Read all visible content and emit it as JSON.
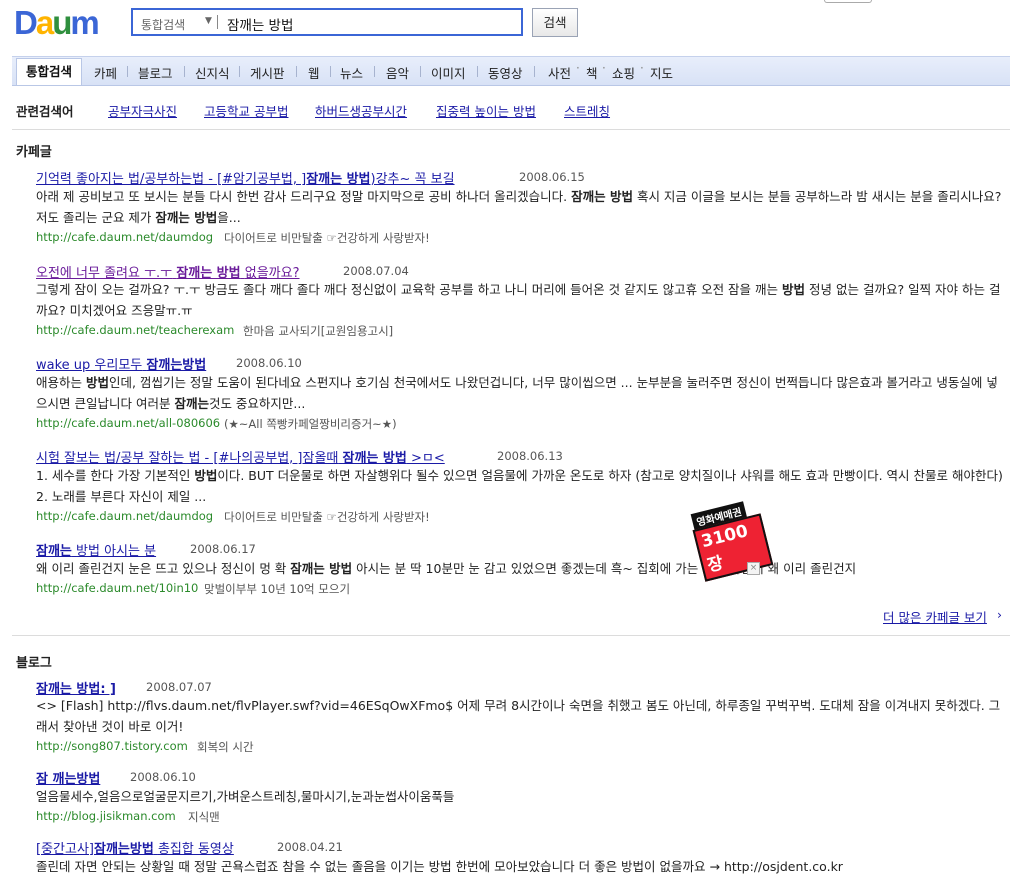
{
  "logo": {
    "text": "Daum",
    "colors": [
      "#ffb400",
      "#3b66d6",
      "#e2343a",
      "#2f8f3e"
    ]
  },
  "search": {
    "category": "통합검색",
    "query": "잠깨는 방법",
    "button": "검색"
  },
  "tabs": [
    {
      "label": "통합검색",
      "active": true
    },
    {
      "label": "카페"
    },
    {
      "label": "블로그"
    },
    {
      "label": "신지식"
    },
    {
      "label": "게시판"
    },
    {
      "label": "웹"
    },
    {
      "label": "뉴스"
    },
    {
      "label": "음악"
    },
    {
      "label": "이미지"
    },
    {
      "label": "동영상"
    },
    {
      "label": "사전"
    },
    {
      "label": "책"
    },
    {
      "label": "쇼핑"
    },
    {
      "label": "지도"
    }
  ],
  "related": {
    "label": "관련검색어",
    "items": [
      "공부자극사진",
      "고등학교 공부법",
      "하버드생공부시간",
      "집중력 높이는 방법",
      "스트레칭"
    ]
  },
  "cafe": {
    "title": "카페글",
    "results": [
      {
        "title_pre": "기억력 좋아지는 법/공부하는법 - [#암기공부법, ]",
        "title_bold": "잠깨는 방법",
        "title_post": ")강추~ 꼭 보길",
        "date": "2008.06.15",
        "snippet_1": "아래 제 공비보고 또 보시는 분들 다시 한번 감사 드리구요 정말 마지막으로 공비 하나더 올리겠습니다.",
        "snippet_bold_1": "잠깨는 방법",
        "snippet_2": "혹시 지금 이글을 보시는 분들 공부하느라 밤 새시는 분을 졸리시나요? 저도 졸리는 군요 제가",
        "snippet_bold_2": "잠깨는 방법",
        "snippet_3": "을...",
        "url": "http://cafe.daum.net/daumdog",
        "cafe": "다이어트로 비만탈출 ☞건강하게 사랑받자!"
      },
      {
        "title_pre": "오전에 너무 졸려요 ㅜ.ㅜ",
        "title_bold": "잠깨는 방법",
        "title_post": "없을까요?",
        "date": "2008.07.04",
        "snippet_1": "그렇게 잠이 오는 걸까요? ㅜ.ㅜ 방금도 졸다 깨다 졸다 깨다 정신없이 교육학 공부를 하고 나니 머리에 들어온 것 같지도 않고휴 오전 잠을 깨는",
        "snippet_bold_1": "방법",
        "snippet_2": "정녕 없는 걸까요? 일찍 자야 하는 걸까요? 미치겠어요 즈응말ㅠ.ㅠ",
        "url": "http://cafe.daum.net/teacherexam",
        "cafe": "한마음 교사되기[교원임용고시]"
      },
      {
        "title_pre": "wake up 우리모두",
        "title_bold": "잠깨는방법",
        "title_post": "",
        "date": "2008.06.10",
        "snippet_1": "애용하는",
        "snippet_bold_1": "방법",
        "snippet_2": "인데, 껌씹기는 정말 도움이 된다네요 스펀지나 호기심 천국에서도 나왔던겁니다, 너무 많이씹으면 ... 눈부분을 눌러주면 정신이 번쩍듭니다 많은효과 볼거라고 냉동실에 넣으시면 큰일납니다 여러분",
        "snippet_bold_2": "잠깨는",
        "snippet_3": "것도 중요하지만...",
        "url": "http://cafe.daum.net/all-080606",
        "cafe": "(★~All 쪽빵카페얼짱비리증거~★)"
      },
      {
        "title_pre": "시험 잘보는 법/공부 잘하는 법 - [#나의공부법, ]잠올때",
        "title_bold": "잠깨는 방법",
        "title_post": ">ㅁ<",
        "date": "2008.06.13",
        "snippet_1": "1. 세수를 한다 가장 기본적인",
        "snippet_bold_1": "방법",
        "snippet_2": "이다. BUT 더운물로 하면 자살행위다 될수 있으면 얼음물에 가까운 온도로 하자 (참고로 양치질이나 샤워를 해도 효과 만빵이다. 역시 찬물로 해야한다) 2. 노래를 부른다 자신이 제일 ...",
        "url": "http://cafe.daum.net/daumdog",
        "cafe": "다이어트로 비만탈출 ☞건강하게 사랑받자!"
      },
      {
        "title_pre": "",
        "title_bold": "잠깨는",
        "title_post": "방법 아시는 분",
        "date": "2008.06.17",
        "snippet_1": "왜 이리 졸린건지 눈은 뜨고 있으나 정신이 멍 확",
        "snippet_bold_1": "잠깨는 방법",
        "snippet_2": "아시는 분 딱 10분만 눈 감고 있었으면 좋겠는데 흑~ 집회에 가는 것도 아닌데 왜 이리 졸린건지",
        "url": "http://cafe.daum.net/10in10",
        "cafe": "맞벌이부부 10년 10억 모으기"
      }
    ],
    "more": "더 많은 카페글 보기",
    "more_arrow": "›",
    "sticker_top": "영화예매권",
    "sticker_main": "3100장"
  },
  "blog": {
    "title": "블로그",
    "results": [
      {
        "title_bold": "잠깨는 방법: ]",
        "date": "2008.07.07",
        "snippet": "<> [Flash] http://flvs.daum.net/flvPlayer.swf?vid=46ESqOwXFmo$ 어제 무려 8시간이나 숙면을 취했고 봄도 아닌데, 하루종일 꾸벅꾸벅. 도대체 잠을 이겨내지 못하겠다. 그래서 찾아낸 것이 바로 이거!",
        "url": "http://song807.tistory.com",
        "source": "회복의 시간"
      },
      {
        "title_bold": "잠 깨는방법",
        "date": "2008.06.10",
        "snippet": "얼음물세수,얼음으로얼굴문지르기,가벼운스트레칭,물마시기,눈과눈썹사이움푹들",
        "url": "http://blog.jisikman.com",
        "source": "지식맨"
      },
      {
        "title_pre": "[중간고사]",
        "title_bold": "잠깨는방법",
        "title_post": "총집합 동영상",
        "date": "2008.04.21",
        "snippet": "졸린데 자면 안되는 상황일 때 정말 곤욕스럽죠 참을 수 없는 졸음을 이기는 방법 한번에 모아보았습니다 더 좋은 방법이 없을까요 → http://osjdent.co.kr"
      }
    ]
  }
}
